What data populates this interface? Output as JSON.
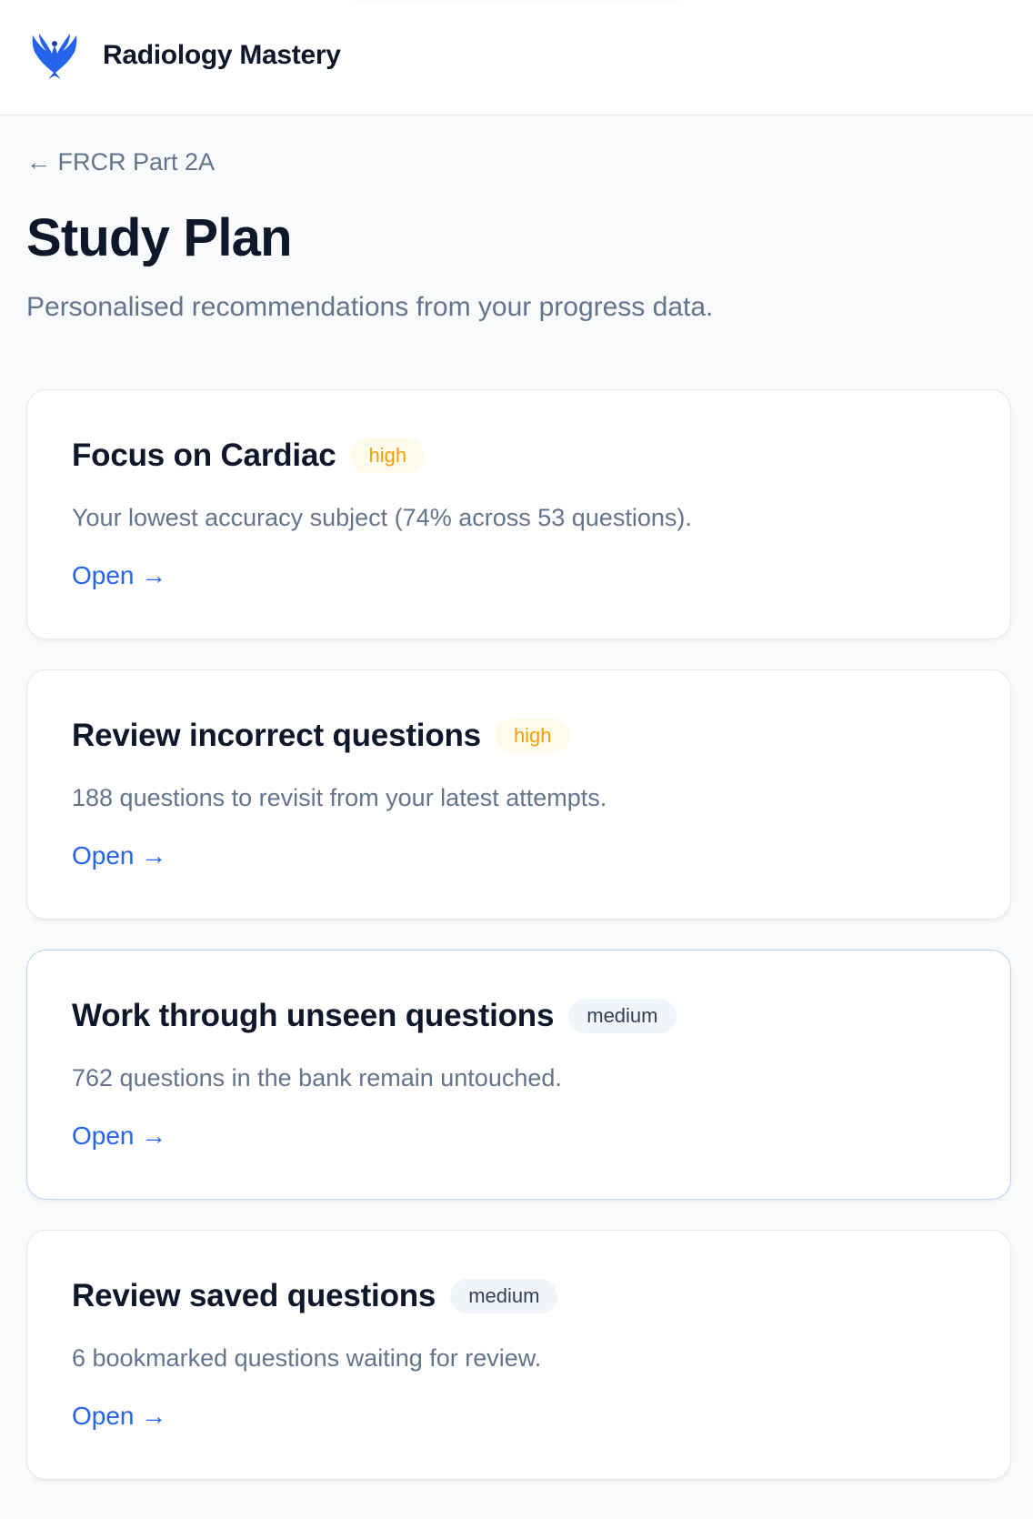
{
  "app": {
    "name": "Radiology Mastery"
  },
  "breadcrumb": {
    "label": "← FRCR Part 2A"
  },
  "header": {
    "title": "Study Plan",
    "subtitle": "Personalised recommendations from your progress data."
  },
  "recommendations": [
    {
      "title": "Focus on Cardiac",
      "priority": "high",
      "description": "Your lowest accuracy subject (74% across 53 questions).",
      "action": "Open →"
    },
    {
      "title": "Review incorrect questions",
      "priority": "high",
      "description": "188 questions to revisit from your latest attempts.",
      "action": "Open →"
    },
    {
      "title": "Work through unseen questions",
      "priority": "medium",
      "description": "762 questions in the bank remain untouched.",
      "action": "Open →"
    },
    {
      "title": "Review saved questions",
      "priority": "medium",
      "description": "6 bookmarked questions waiting for review.",
      "action": "Open →"
    }
  ],
  "colors": {
    "accent": "#2563eb",
    "priority_high": "#f59e0b",
    "priority_high_bg": "#fffbeb",
    "priority_medium_bg": "#f1f5f9",
    "logo": "#2563eb"
  },
  "icons": {
    "logo": "phoenix-icon"
  }
}
